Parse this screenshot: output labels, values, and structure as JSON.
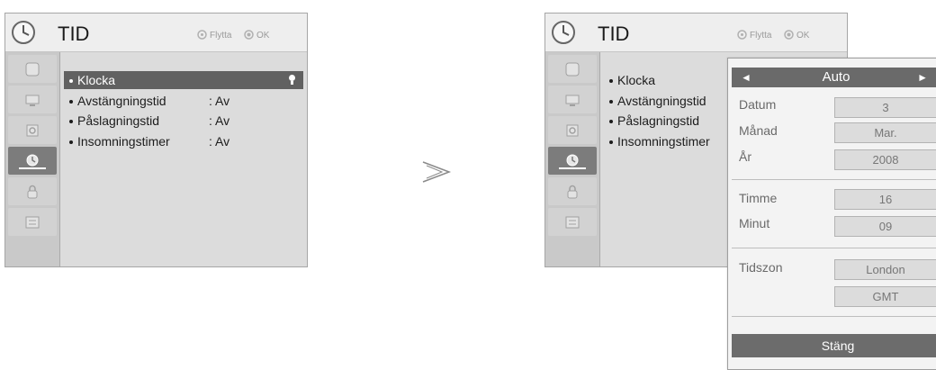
{
  "left_menu": {
    "title": "TID",
    "hint_move": "Flytta",
    "hint_ok": "OK",
    "items": [
      {
        "label": "Klocka",
        "value": ""
      },
      {
        "label": "Avstängningstid",
        "value": ": Av"
      },
      {
        "label": "Påslagningstid",
        "value": ": Av"
      },
      {
        "label": "Insomningstimer",
        "value": ": Av"
      }
    ]
  },
  "right_menu": {
    "title": "TID",
    "hint_move": "Flytta",
    "hint_ok": "OK",
    "items": [
      {
        "label": "Klocka"
      },
      {
        "label": "Avstängningstid"
      },
      {
        "label": "Påslagningstid"
      },
      {
        "label": "Insomningstimer"
      }
    ]
  },
  "clock_popup": {
    "mode": "Auto",
    "mode_left_arrow": "◄",
    "mode_right_arrow": "►",
    "fields": [
      {
        "label": "Datum",
        "value": "3"
      },
      {
        "label": "Månad",
        "value": "Mar."
      },
      {
        "label": "År",
        "value": "2008"
      },
      {
        "label": "Timme",
        "value": "16"
      },
      {
        "label": "Minut",
        "value": "09"
      },
      {
        "label": "Tidszon",
        "value": "London"
      },
      {
        "label": "",
        "value": "GMT"
      }
    ],
    "close_label": "Stäng"
  },
  "sidebar_icons": [
    "picture-icon",
    "screen-icon",
    "audio-icon",
    "clock-icon",
    "lock-icon",
    "option-icon"
  ],
  "active_sidebar_index": 3,
  "colors": {
    "menu_bg": "#d4d4d4",
    "selected": "#616161",
    "popup_bg": "#f3f3f3"
  }
}
